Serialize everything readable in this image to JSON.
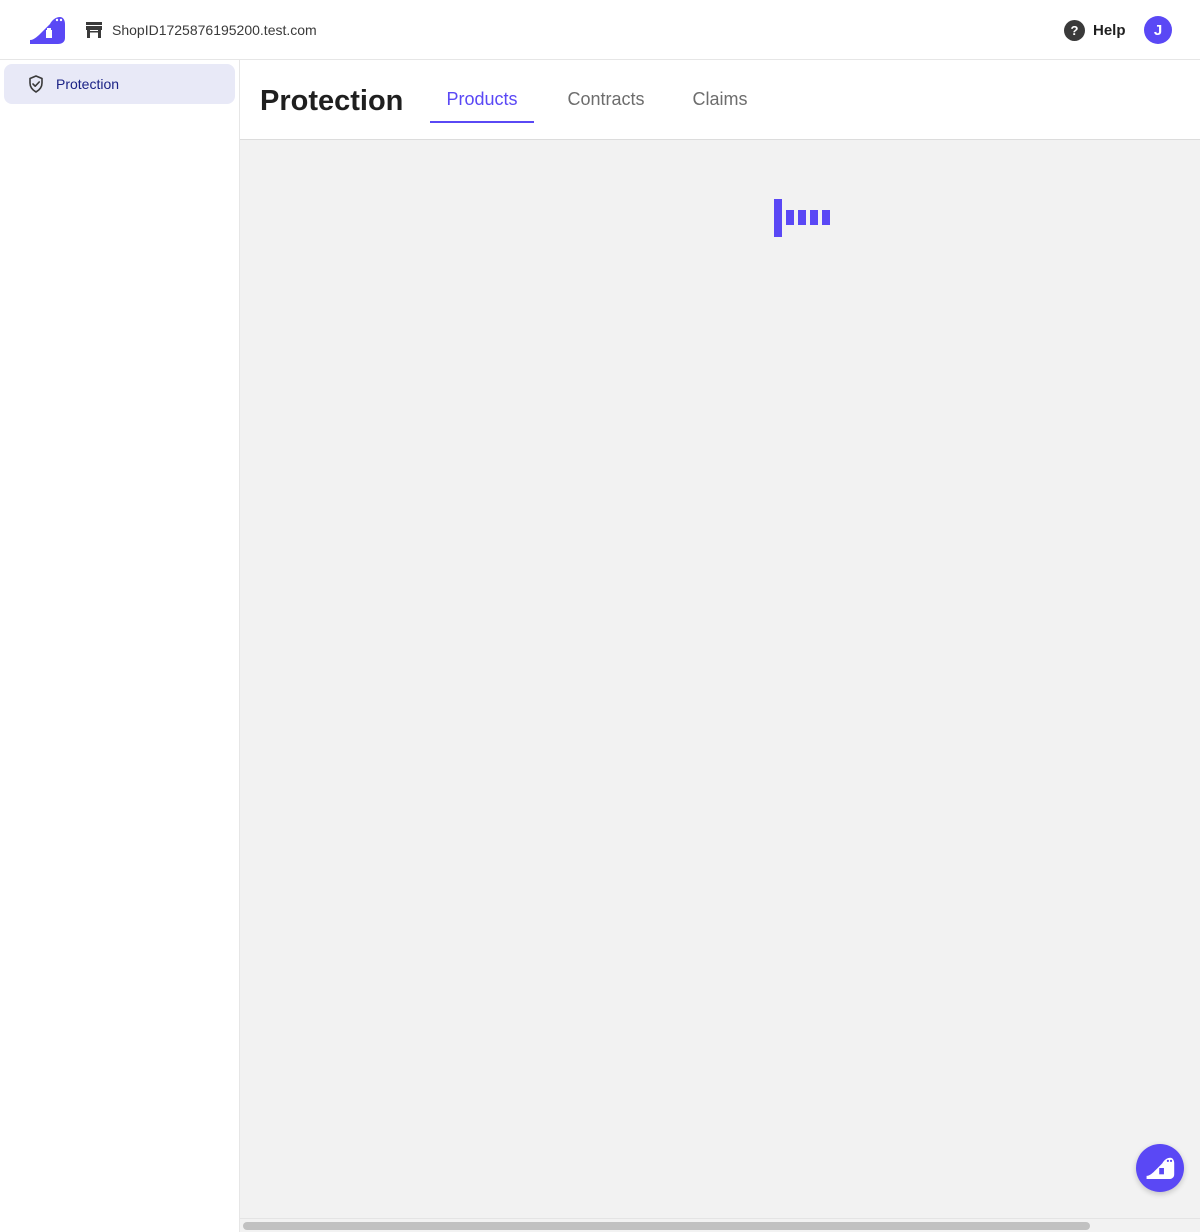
{
  "header": {
    "store_name": "ShopID1725876195200.test.com",
    "help_label": "Help",
    "help_icon_glyph": "?",
    "avatar_initial": "J"
  },
  "sidebar": {
    "items": [
      {
        "label": "Protection",
        "icon": "shield-check-icon",
        "active": true
      }
    ]
  },
  "page": {
    "title": "Protection",
    "tabs": [
      {
        "label": "Products",
        "active": true
      },
      {
        "label": "Contracts",
        "active": false
      },
      {
        "label": "Claims",
        "active": false
      }
    ]
  },
  "colors": {
    "accent": "#5a48f5",
    "sidebar_active_bg": "#e8e9f7",
    "sidebar_active_text": "#1b2286",
    "content_bg": "#f2f2f2"
  },
  "icons": {
    "logo": "brand-logo-icon",
    "store": "storefront-icon",
    "help": "help-circle-icon",
    "loader": "loading-bars-icon",
    "fab": "chat-assistant-icon"
  }
}
